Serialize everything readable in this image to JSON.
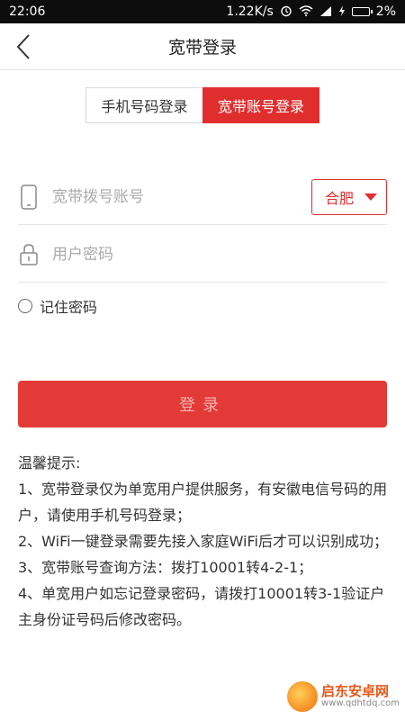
{
  "status": {
    "time": "22:06",
    "speed": "1.22K/s",
    "battery": "2%"
  },
  "header": {
    "title": "宽带登录"
  },
  "tabs": {
    "phone_label": "手机号码登录",
    "broadband_label": "宽带账号登录"
  },
  "form": {
    "account_placeholder": "宽带拨号账号",
    "password_placeholder": "用户密码",
    "city": "合肥",
    "remember_label": "记住密码",
    "login_label": "登录"
  },
  "tips": {
    "title": "温馨提示:",
    "items": [
      "1、宽带登录仅为单宽用户提供服务，有安徽电信号码的用户，请使用手机号码登录；",
      "2、WiFi一键登录需要先接入家庭WiFi后才可以识别成功；",
      "3、宽带账号查询方法：拨打10001转4-2-1；",
      "4、单宽用户如忘记登录密码，请拨打10001转3-1验证户主身份证号码后修改密码。"
    ]
  },
  "watermark": {
    "title": "启东安卓网",
    "url": "www.qdhtdq.com"
  },
  "colors": {
    "accent": "#e02e2e",
    "button": "#e23a36"
  }
}
